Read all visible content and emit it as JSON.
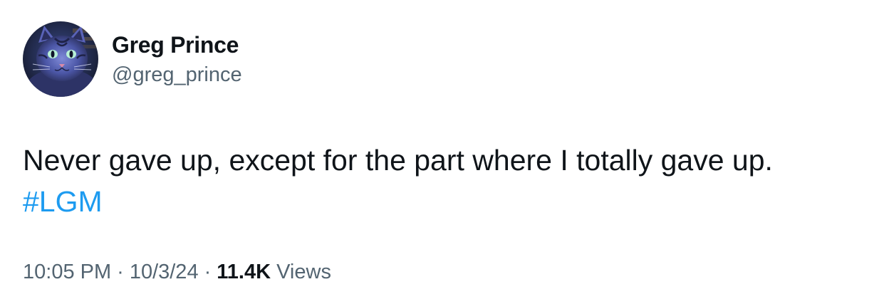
{
  "author": {
    "name": "Greg Prince",
    "handle": "@greg_prince",
    "avatar_icon": "cat-avatar"
  },
  "tweet": {
    "text_line1": "Never gave up, except for the part where I totally gave up.",
    "hashtag": "#LGM"
  },
  "meta": {
    "time": "10:05 PM",
    "separator": "·",
    "date": "10/3/24",
    "views_count": "11.4K",
    "views_label": "Views"
  },
  "colors": {
    "text": "#0f1419",
    "secondary": "#536471",
    "link": "#1d9bf0"
  }
}
